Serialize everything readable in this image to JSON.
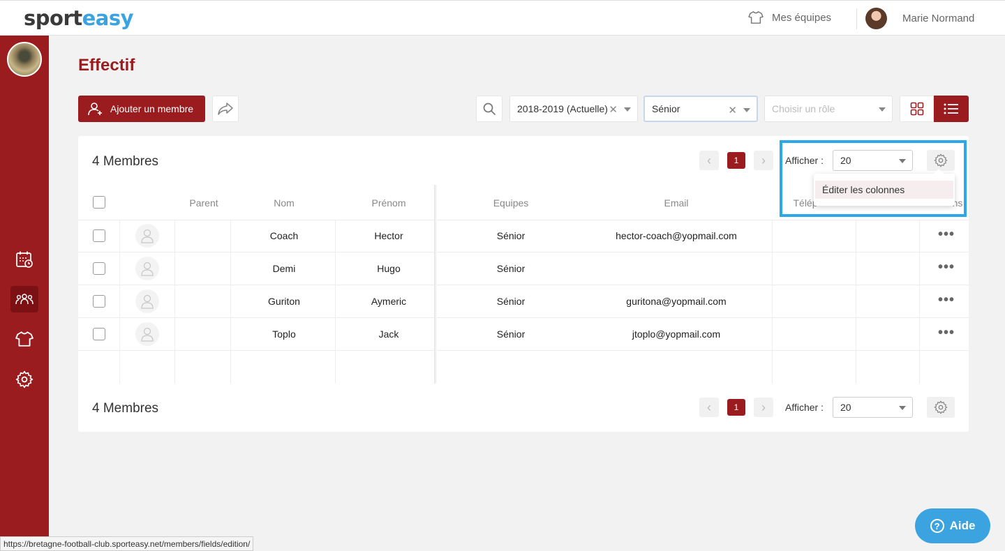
{
  "brand": {
    "part1": "sport",
    "part2": "easy"
  },
  "topbar": {
    "teams_label": "Mes équipes",
    "user_name": "Marie Normand"
  },
  "page": {
    "title": "Effectif"
  },
  "toolbar": {
    "add_member": "Ajouter un membre",
    "season": "2018-2019 (Actuelle)",
    "team": "Sénior",
    "role_placeholder": "Choisir un rôle"
  },
  "summary": {
    "members_count": "4 Membres",
    "current_page": "1",
    "show_label": "Afficher :",
    "per_page": "20"
  },
  "columns": {
    "parent": "Parent",
    "nom": "Nom",
    "prenom": "Prénom",
    "equipes": "Equipes",
    "email": "Email",
    "telephone": "Télép",
    "actions": "ns"
  },
  "rows": [
    {
      "nom": "Coach",
      "prenom": "Hector",
      "equipe": "Sénior",
      "email": "hector-coach@yopmail.com"
    },
    {
      "nom": "Demi",
      "prenom": "Hugo",
      "equipe": "Sénior",
      "email": ""
    },
    {
      "nom": "Guriton",
      "prenom": "Aymeric",
      "equipe": "Sénior",
      "email": "guritona@yopmail.com"
    },
    {
      "nom": "Toplo",
      "prenom": "Jack",
      "equipe": "Sénior",
      "email": "jtoplo@yopmail.com"
    }
  ],
  "dropdown": {
    "edit_columns": "Éditer les colonnes"
  },
  "help": {
    "label": "Aide"
  },
  "status_url": "https://bretagne-football-club.sporteasy.net/members/fields/edition/",
  "colors": {
    "primary": "#9b1c1f",
    "accent": "#3aa3e0",
    "highlight": "#2aa8ea"
  }
}
